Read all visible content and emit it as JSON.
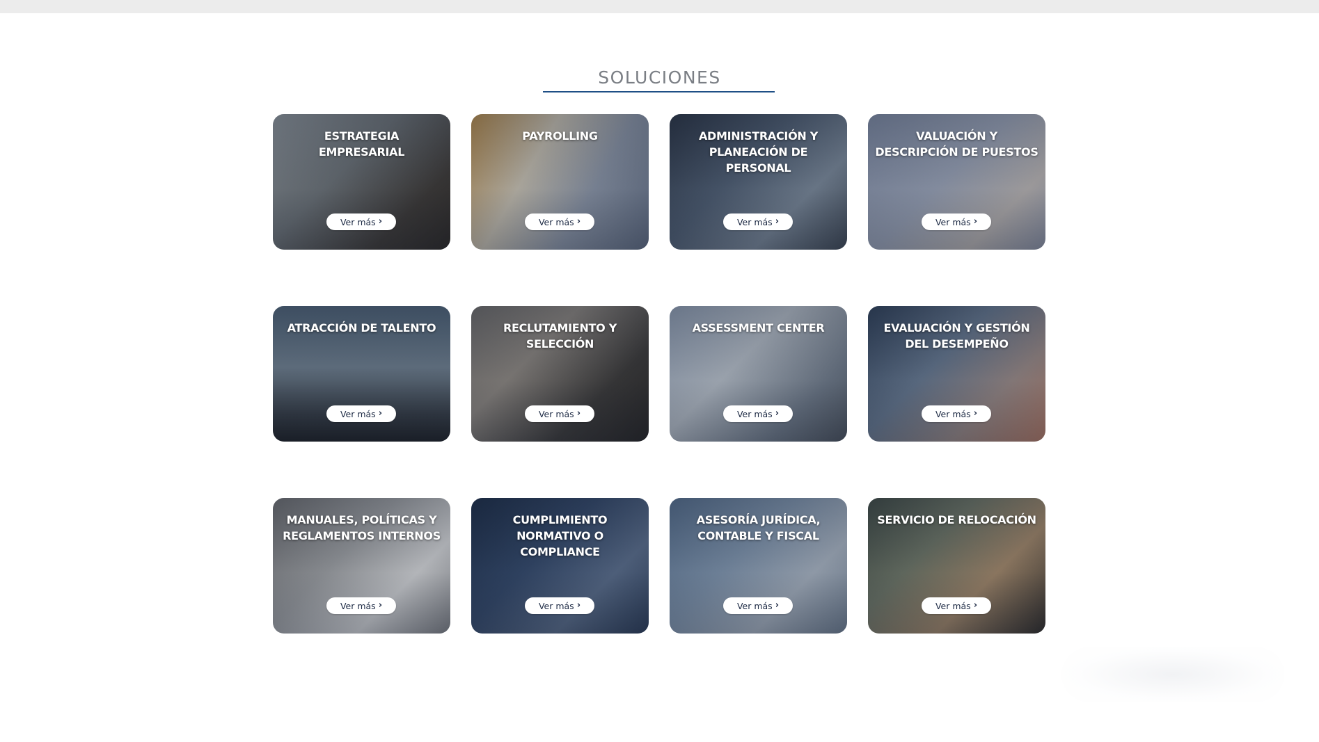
{
  "page": {
    "section_title": "SOLUCIONES"
  },
  "cards": [
    {
      "title": "ESTRATEGIA EMPRESARIAL",
      "button_label": "Ver más",
      "bg": "bg-1"
    },
    {
      "title": "PAYROLLING",
      "button_label": "Ver más",
      "bg": "bg-2"
    },
    {
      "title": "ADMINISTRACIÓN Y PLANEACIÓN DE PERSONAL",
      "button_label": "Ver más",
      "bg": "bg-3"
    },
    {
      "title": "VALUACIÓN Y DESCRIPCIÓN DE PUESTOS",
      "button_label": "Ver más",
      "bg": "bg-4"
    },
    {
      "title": "ATRACCIÓN DE TALENTO",
      "button_label": "Ver más",
      "bg": "bg-5"
    },
    {
      "title": "RECLUTAMIENTO Y SELECCIÓN",
      "button_label": "Ver más",
      "bg": "bg-6"
    },
    {
      "title": "ASSESSMENT CENTER",
      "button_label": "Ver más",
      "bg": "bg-7"
    },
    {
      "title": "EVALUACIÓN Y GESTIÓN DEL DESEMPEÑO",
      "button_label": "Ver más",
      "bg": "bg-8"
    },
    {
      "title": "MANUALES, POLÍTICAS Y REGLAMENTOS INTERNOS",
      "button_label": "Ver más",
      "bg": "bg-9"
    },
    {
      "title": "CUMPLIMIENTO NORMATIVO O COMPLIANCE",
      "button_label": "Ver más",
      "bg": "bg-10"
    },
    {
      "title": "ASESORÍA JURÍDICA, CONTABLE Y FISCAL",
      "button_label": "Ver más",
      "bg": "bg-11"
    },
    {
      "title": "SERVICIO DE RELOCACIÓN",
      "button_label": "Ver más",
      "bg": "bg-12"
    }
  ],
  "colors": {
    "accent_underline": "#1f4f86",
    "title_gray": "#7a7e84",
    "button_text": "#1d2a44"
  },
  "icons": {
    "button_chevron": "chevron-right-icon"
  }
}
